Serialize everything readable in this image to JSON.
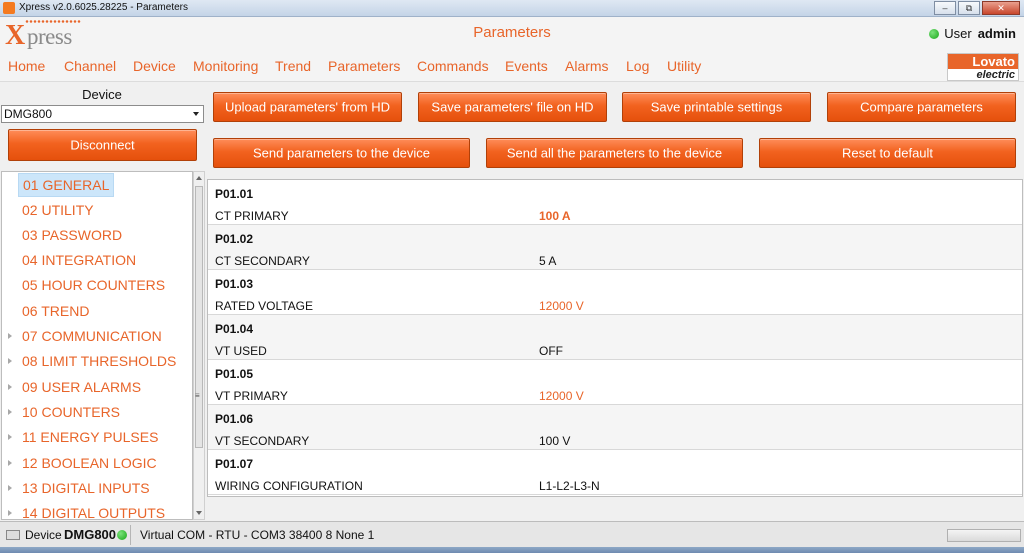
{
  "window": {
    "title": "Xpress v2.0.6025.28225 - Parameters"
  },
  "header": {
    "logo_x": "X",
    "logo_press": "press",
    "title": "Parameters",
    "user_label": "User",
    "user_name": "admin",
    "user_status_color": "#22b022"
  },
  "menu": [
    {
      "label": "Home"
    },
    {
      "label": "Channel"
    },
    {
      "label": "Device"
    },
    {
      "label": "Monitoring"
    },
    {
      "label": "Trend"
    },
    {
      "label": "Parameters"
    },
    {
      "label": "Commands"
    },
    {
      "label": "Events"
    },
    {
      "label": "Alarms"
    },
    {
      "label": "Log"
    },
    {
      "label": "Utility"
    }
  ],
  "brand": {
    "top": "Lovato",
    "bottom": "electric"
  },
  "sidebar": {
    "device_label": "Device",
    "device_value": "DMG800",
    "disconnect_label": "Disconnect",
    "tree": [
      {
        "label": "01 GENERAL",
        "selected": true,
        "expandable": false
      },
      {
        "label": "02 UTILITY",
        "expandable": false
      },
      {
        "label": "03 PASSWORD",
        "expandable": false
      },
      {
        "label": "04 INTEGRATION",
        "expandable": false
      },
      {
        "label": "05 HOUR COUNTERS",
        "expandable": false
      },
      {
        "label": "06 TREND",
        "expandable": false
      },
      {
        "label": "07 COMMUNICATION",
        "expandable": true
      },
      {
        "label": "08 LIMIT THRESHOLDS",
        "expandable": true
      },
      {
        "label": "09 USER ALARMS",
        "expandable": true
      },
      {
        "label": "10 COUNTERS",
        "expandable": true
      },
      {
        "label": "11 ENERGY PULSES",
        "expandable": true
      },
      {
        "label": "12 BOOLEAN LOGIC",
        "expandable": true
      },
      {
        "label": "13 DIGITAL INPUTS",
        "expandable": true
      },
      {
        "label": "14 DIGITAL OUTPUTS",
        "expandable": true
      }
    ]
  },
  "toolbar": {
    "upload_label": "Upload parameters' from HD",
    "save_file_label": "Save parameters' file on HD",
    "save_printable_label": "Save printable settings",
    "compare_label": "Compare parameters",
    "send_label": "Send parameters to the device",
    "send_all_label": "Send all the parameters to the device",
    "reset_label": "Reset to default"
  },
  "parameters": [
    {
      "code": "P01.01",
      "name": "CT PRIMARY",
      "value": "100  A"
    },
    {
      "code": "P01.02",
      "name": "CT SECONDARY",
      "value": "5  A"
    },
    {
      "code": "P01.03",
      "name": "RATED VOLTAGE",
      "value": "12000  V"
    },
    {
      "code": "P01.04",
      "name": "VT USED",
      "value": "OFF"
    },
    {
      "code": "P01.05",
      "name": "VT PRIMARY",
      "value": "12000  V"
    },
    {
      "code": "P01.06",
      "name": "VT SECONDARY",
      "value": "100  V"
    },
    {
      "code": "P01.07",
      "name": "WIRING CONFIGURATION",
      "value": "L1-L2-L3-N"
    }
  ],
  "statusbar": {
    "device_label": "Device",
    "device_name": "DMG800",
    "connection": "Virtual COM - RTU - COM3 38400 8 None 1"
  },
  "colors": {
    "accent": "#e8652a",
    "selection": "#cce6fa"
  }
}
